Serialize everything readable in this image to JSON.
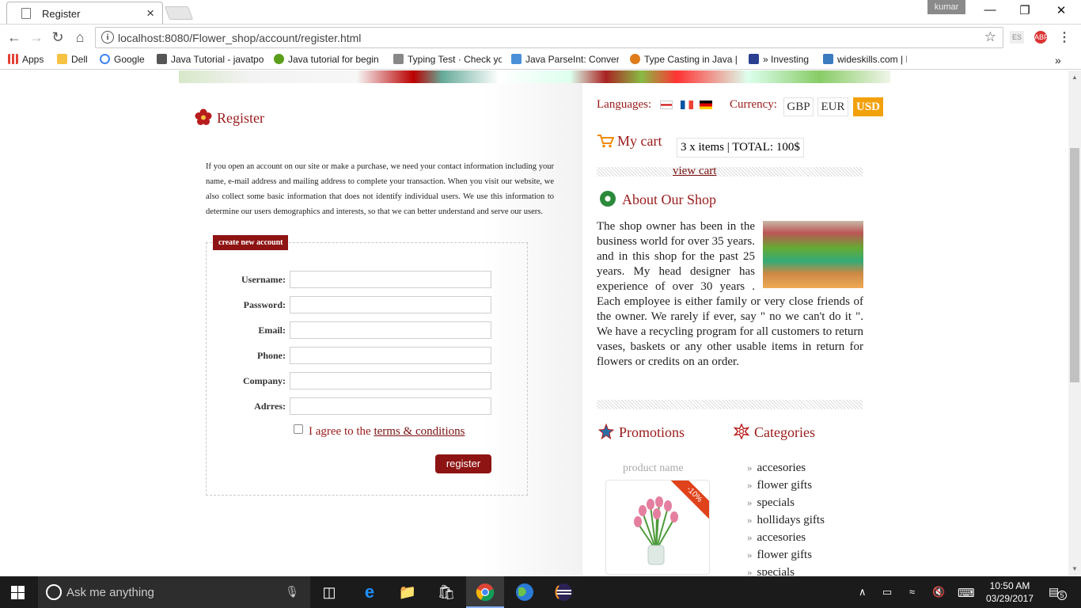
{
  "browser": {
    "tab_title": "Register",
    "tab_close": "×",
    "profile": "kumar",
    "url": "localhost:8080/Flower_shop/account/register.html",
    "ext_es": "ES",
    "ext_abp": "ABP",
    "bookmarks": [
      {
        "label": "Apps",
        "color": "#e34133"
      },
      {
        "label": "Dell",
        "color": "#f6c243"
      },
      {
        "label": "Google",
        "color": "#4285f4"
      },
      {
        "label": "Java Tutorial - javatpo",
        "color": "#555555"
      },
      {
        "label": "Java tutorial for begin",
        "color": "#5a9e1a"
      },
      {
        "label": "Typing Test · Check yo",
        "color": "#888888"
      },
      {
        "label": "Java ParseInt: Convert",
        "color": "#4a90d9"
      },
      {
        "label": "Type Casting in Java |",
        "color": "#e07b1a"
      },
      {
        "label": "» Investing",
        "color": "#2a3f8f"
      },
      {
        "label": "wideskills.com | Devel",
        "color": "#3b7bbf"
      }
    ],
    "bookmarks_more": "»"
  },
  "left": {
    "title": "Register",
    "intro": "If you open an account on our site or make a purchase, we need your contact information including your name, e-mail address and mailing address to complete your transaction. When you visit our website, we also collect some basic information that does not identify individual users. We use this information to determine our users demographics and interests, so that we can better understand and serve our users.",
    "legend": "create new account",
    "fields": {
      "username": "Username:",
      "password": "Password:",
      "email": "Email:",
      "phone": "Phone:",
      "company": "Company:",
      "address": "Adrres:"
    },
    "agree_prefix": "I agree to the",
    "agree_link": "terms & conditions",
    "register_button": "register"
  },
  "right": {
    "languages_label": "Languages:",
    "currency_label": "Currency:",
    "currencies": [
      "GBP",
      "EUR",
      "USD"
    ],
    "active_currency": "USD",
    "cart_title": "My cart",
    "cart_summary": "3 x items | TOTAL: 100$",
    "view_cart": "view cart",
    "about_title": "About Our Shop",
    "about_text": "The shop owner has been in the business world for over 35 years. and in this shop for the past 25 years. My head designer has experience of over 30 years . Each employee is either family or very close friends of the owner. We rarely if ever, say \" no we can't do it \". We have a recycling program for all customers to return vases, baskets or any other usable items in return for flowers or credits on an order.",
    "promotions_title": "Promotions",
    "categories_title": "Categories",
    "product_name": "product name",
    "discount": "-10%",
    "categories": [
      "accesories",
      "flower gifts",
      "specials",
      "hollidays gifts",
      "accesories",
      "flower gifts",
      "specials"
    ]
  },
  "taskbar": {
    "search_placeholder": "Ask me anything",
    "time": "10:50 AM",
    "date": "03/29/2017",
    "notifications": "5"
  },
  "colors": {
    "brand_red": "#9a1a1a",
    "button_red": "#8e1313",
    "currency_active": "#f2a10d"
  }
}
